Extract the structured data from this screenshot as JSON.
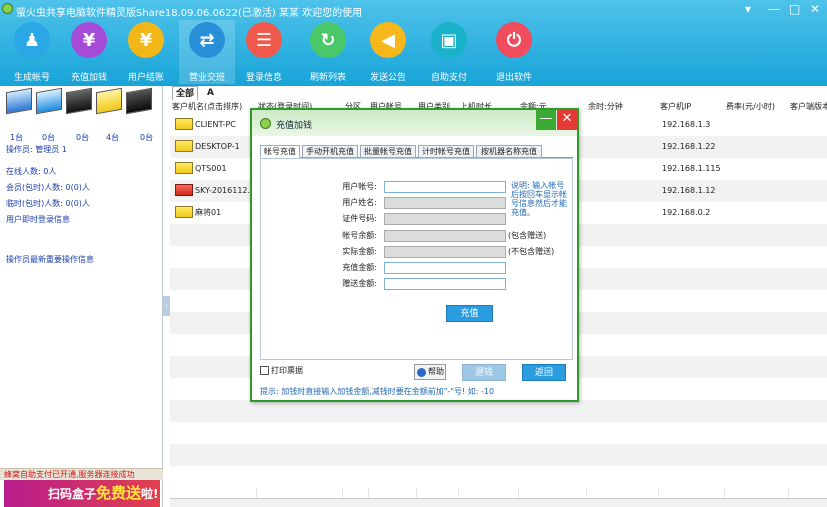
{
  "window": {
    "title": "萤火虫共享电脑软件精灵版Share18.09.06.0622(已激活)  某某 欢迎您的使用",
    "controls": [
      "▾",
      "—",
      "□",
      "✕"
    ]
  },
  "toolbar": [
    {
      "label": "生成帐号",
      "icon": "user-add-icon",
      "glyph": "♟",
      "color": "#2aa8e6"
    },
    {
      "label": "充值加钱",
      "icon": "yen-icon",
      "glyph": "¥",
      "color": "#a54bd8"
    },
    {
      "label": "用户结账",
      "icon": "checkout-icon",
      "glyph": "¥",
      "color": "#f2b616"
    },
    {
      "label": "营业交班",
      "icon": "handover-icon",
      "glyph": "⇄",
      "color": "#2790d8"
    },
    {
      "label": "登录信息",
      "icon": "login-info-icon",
      "glyph": "☰",
      "color": "#ef5a4c"
    },
    {
      "label": "刷新列表",
      "icon": "refresh-icon",
      "glyph": "↻",
      "color": "#49c86a"
    },
    {
      "label": "发送公告",
      "icon": "megaphone-icon",
      "glyph": "◀",
      "color": "#f6b71a"
    },
    {
      "label": "自助支付",
      "icon": "self-pay-icon",
      "glyph": "▣",
      "color": "#19b2c9"
    },
    {
      "label": "退出软件",
      "icon": "power-icon",
      "glyph": "⏻",
      "color": "#f14b5e"
    }
  ],
  "sidebar": {
    "counts": [
      "1台",
      "0台",
      "0台",
      "4台",
      "0台"
    ],
    "operator": "操作员: 管理员 1",
    "online": "在线人数: 0人",
    "member": "会员(包时)人数: 0(0)人",
    "temp": "临时(包时)人数: 0(0)人",
    "login_info": "用户即时登录信息",
    "op_info": "操作员最新重要操作信息",
    "status": "蜂窝自助支付已开通,服务器连接成功",
    "ad_prefix": "扫码盒子",
    "ad_main": "免费送",
    "ad_suffix": "啦!"
  },
  "tabs": [
    "全部",
    "A"
  ],
  "grid": {
    "headers": [
      "客户机名(点击排序)",
      "状态(登录时间)",
      "分区",
      "用户帐号",
      "用户类别",
      "上机时长",
      "余额:元",
      "余时:分钟",
      "客户机IP",
      "费率(元/小时)",
      "客户端版本"
    ],
    "rows": [
      {
        "name": "CLIENT-PC",
        "ip": "192.168.1.3",
        "status": "normal"
      },
      {
        "name": "DESKTOP-1",
        "ip": "192.168.1.22",
        "status": "normal"
      },
      {
        "name": "QTS001",
        "ip": "192.168.1.115",
        "status": "normal"
      },
      {
        "name": "SKY-2016112...",
        "ip": "192.168.1.12",
        "status": "offline"
      },
      {
        "name": "麻将01",
        "ip": "192.168.0.2",
        "status": "normal"
      }
    ]
  },
  "dialog": {
    "title": "充值加钱",
    "tabs": [
      "帐号充值",
      "手动开机充值",
      "批量帐号充值",
      "计时帐号充值",
      "按机器名称充值"
    ],
    "fields": [
      {
        "label": "用户帐号:",
        "value": "",
        "readonly": false,
        "note": ""
      },
      {
        "label": "用户姓名:",
        "value": "",
        "readonly": true,
        "note": ""
      },
      {
        "label": "证件号码:",
        "value": "",
        "readonly": true,
        "note": ""
      },
      {
        "label": "帐号余额:",
        "value": "",
        "readonly": true,
        "note": "(包含赠送)"
      },
      {
        "label": "实际金额:",
        "value": "",
        "readonly": true,
        "note": "(不包含赠送)"
      },
      {
        "label": "充值金额:",
        "value": "",
        "readonly": false,
        "note": ""
      },
      {
        "label": "赠送金额:",
        "value": "",
        "readonly": false,
        "note": ""
      }
    ],
    "note": "说明: 输入帐号后按回车显示帐号信息然后才能充值。",
    "recharge": "充值",
    "print": "打印票据",
    "help": "帮助",
    "refund": "退钱",
    "back": "返回",
    "tip": "提示: 加钱时直接输入加钱金额,减钱时要在金额前加\"-\"号! 如: -10"
  }
}
